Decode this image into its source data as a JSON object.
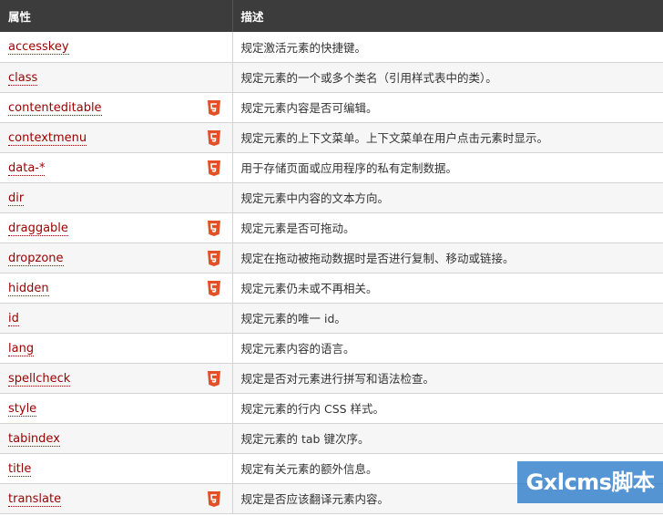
{
  "table": {
    "headers": [
      "属性",
      "描述"
    ],
    "rows": [
      {
        "name": "accesskey",
        "html5": false,
        "desc": "规定激活元素的快捷键。"
      },
      {
        "name": "class",
        "html5": false,
        "desc": "规定元素的一个或多个类名（引用样式表中的类）。"
      },
      {
        "name": "contenteditable",
        "html5": true,
        "desc": "规定元素内容是否可编辑。"
      },
      {
        "name": "contextmenu",
        "html5": true,
        "desc": "规定元素的上下文菜单。上下文菜单在用户点击元素时显示。"
      },
      {
        "name": "data-*",
        "html5": true,
        "desc": "用于存储页面或应用程序的私有定制数据。"
      },
      {
        "name": "dir",
        "html5": false,
        "desc": "规定元素中内容的文本方向。"
      },
      {
        "name": "draggable",
        "html5": true,
        "desc": "规定元素是否可拖动。"
      },
      {
        "name": "dropzone",
        "html5": true,
        "desc": "规定在拖动被拖动数据时是否进行复制、移动或链接。"
      },
      {
        "name": "hidden",
        "html5": true,
        "desc": "规定元素仍未或不再相关。"
      },
      {
        "name": "id",
        "html5": false,
        "desc": "规定元素的唯一 id。"
      },
      {
        "name": "lang",
        "html5": false,
        "desc": "规定元素内容的语言。"
      },
      {
        "name": "spellcheck",
        "html5": true,
        "desc": "规定是否对元素进行拼写和语法检查。"
      },
      {
        "name": "style",
        "html5": false,
        "desc": "规定元素的行内 CSS 样式。"
      },
      {
        "name": "tabindex",
        "html5": false,
        "desc": "规定元素的 tab 键次序。"
      },
      {
        "name": "title",
        "html5": false,
        "desc": "规定有关元素的额外信息。"
      },
      {
        "name": "translate",
        "html5": true,
        "desc": "规定是否应该翻译元素内容。"
      }
    ]
  },
  "badge_icon": "html5-shield-icon",
  "colors": {
    "header_bg": "#3c3c3c",
    "link": "#990000",
    "badge": "#e34f26",
    "watermark": "#2878c8"
  },
  "watermark": {
    "text": "Gxlcms脚本"
  }
}
